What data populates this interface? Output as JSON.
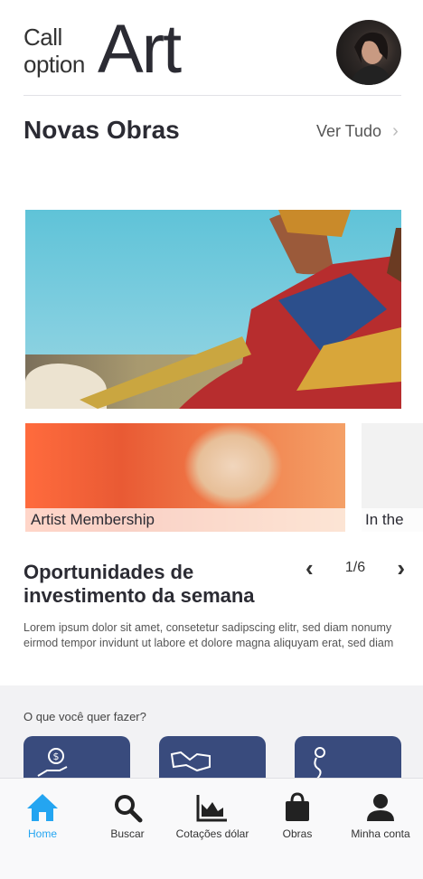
{
  "header": {
    "logo_line1": "Call",
    "logo_line2": "option",
    "logo_big": "Art"
  },
  "new_works": {
    "title": "Novas Obras",
    "see_all": "Ver Tudo"
  },
  "carousel": {
    "items": [
      {
        "label": "Artist Membership"
      },
      {
        "label": "In the"
      }
    ]
  },
  "opportunities": {
    "title": "Oportunidades de investimento da semana",
    "page": "1/6",
    "description": "Lorem ipsum dolor sit amet, consetetur sadipscing elitr, sed diam nonumy eirmod tempor invidunt ut labore et dolore magna aliquyam erat, sed diam"
  },
  "actions": {
    "title": "O que você quer fazer?",
    "cards": [
      {
        "icon": "money-hand-icon"
      },
      {
        "icon": "handshake-icon"
      },
      {
        "icon": "sculpture-icon"
      }
    ]
  },
  "tabbar": {
    "tabs": [
      {
        "label": "Home",
        "icon": "home-icon",
        "active": true
      },
      {
        "label": "Buscar",
        "icon": "search-icon",
        "active": false
      },
      {
        "label": "Cotações dólar",
        "icon": "chart-icon",
        "active": false
      },
      {
        "label": "Obras",
        "icon": "bag-icon",
        "active": false
      },
      {
        "label": "Minha conta",
        "icon": "user-icon",
        "active": false
      }
    ]
  },
  "colors": {
    "accent": "#24a5f1",
    "card_bg": "#394b7d",
    "text": "#2b2b33"
  }
}
